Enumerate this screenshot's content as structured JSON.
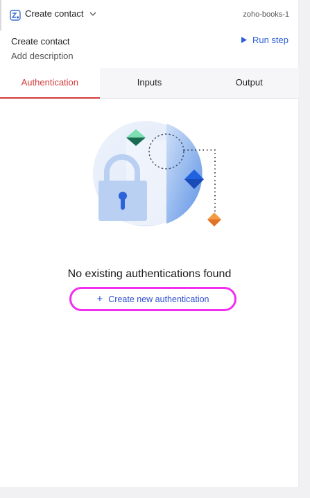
{
  "header": {
    "step_name": "Create contact",
    "step_id": "zoho-books-1",
    "title": "Create contact",
    "description_placeholder": "Add description",
    "run_label": "Run step"
  },
  "tabs": [
    {
      "label": "Authentication",
      "active": true
    },
    {
      "label": "Inputs",
      "active": false
    },
    {
      "label": "Output",
      "active": false
    }
  ],
  "empty_state": {
    "title": "No existing authentications found",
    "button_label": "Create new authentication",
    "button_icon": "plus-icon"
  },
  "colors": {
    "accent_red": "#d23a3a",
    "link_blue": "#2c4fcf",
    "highlight_magenta": "#f22ef0"
  }
}
